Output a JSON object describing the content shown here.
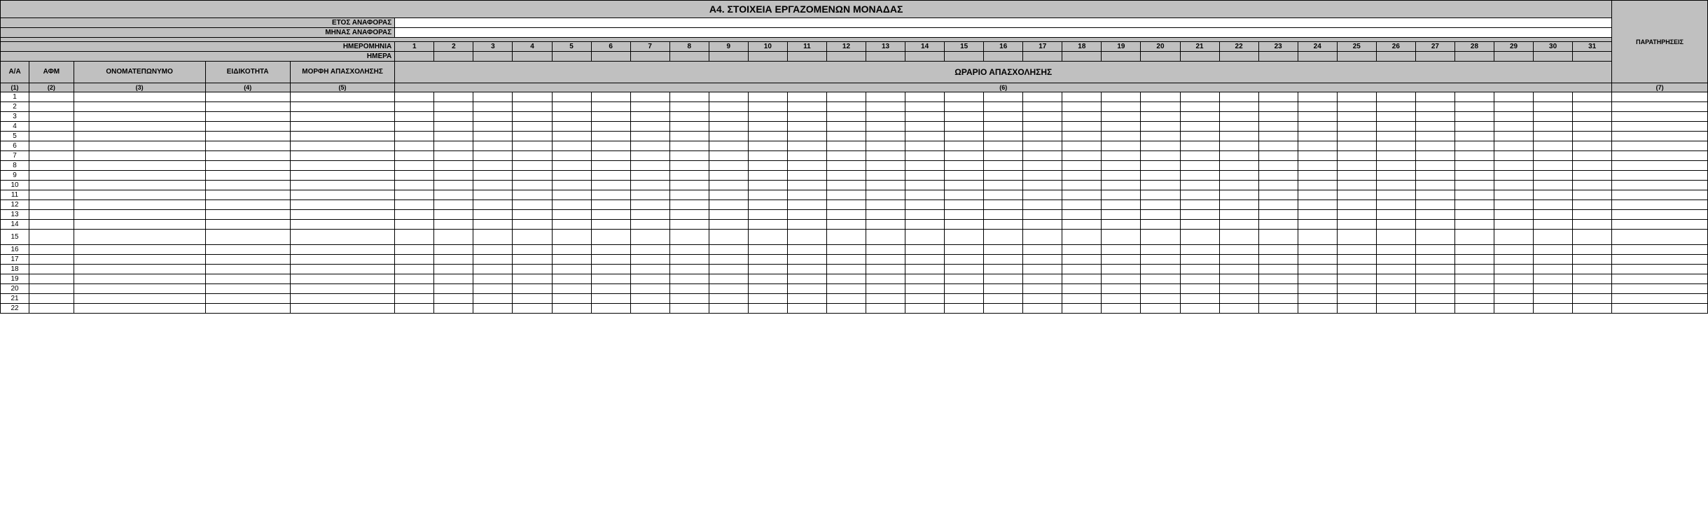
{
  "title": "Α4. ΣΤΟΙΧΕΙΑ ΕΡΓΑΖΟΜΕΝΩΝ ΜΟΝΑΔΑΣ",
  "labels": {
    "year": "ΕΤΟΣ ΑΝΑΦΟΡΑΣ",
    "month": "ΜΗΝΑΣ ΑΝΑΦΟΡΑΣ",
    "date": "ΗΜΕΡΟΜΗΝΙΑ",
    "day": "ΗΜΕΡΑ",
    "aa": "Α/Α",
    "afm": "ΑΦΜ",
    "fullname": "ΟΝΟΜΑΤΕΠΩΝΥΜΟ",
    "specialty": "ΕΙΔΙΚΟΤΗΤΑ",
    "employment_type": "ΜΟΡΦΗ ΑΠΑΣΧΟΛΗΣΗΣ",
    "schedule": "ΩΡΑΡΙΟ ΑΠΑΣΧΟΛΗΣΗΣ",
    "notes": "ΠΑΡΑΤΗΡΗΣΕΙΣ"
  },
  "values": {
    "year": "",
    "month": ""
  },
  "days": [
    "1",
    "2",
    "3",
    "4",
    "5",
    "6",
    "7",
    "8",
    "9",
    "10",
    "11",
    "12",
    "13",
    "14",
    "15",
    "16",
    "17",
    "18",
    "19",
    "20",
    "21",
    "22",
    "23",
    "24",
    "25",
    "26",
    "27",
    "28",
    "29",
    "30",
    "31"
  ],
  "colnums": {
    "c1": "(1)",
    "c2": "(2)",
    "c3": "(3)",
    "c4": "(4)",
    "c5": "(5)",
    "c6": "(6)",
    "c7": "(7)"
  },
  "rows": [
    "1",
    "2",
    "3",
    "4",
    "5",
    "6",
    "7",
    "8",
    "9",
    "10",
    "11",
    "12",
    "13",
    "14",
    "15",
    "16",
    "17",
    "18",
    "19",
    "20",
    "21",
    "22"
  ]
}
